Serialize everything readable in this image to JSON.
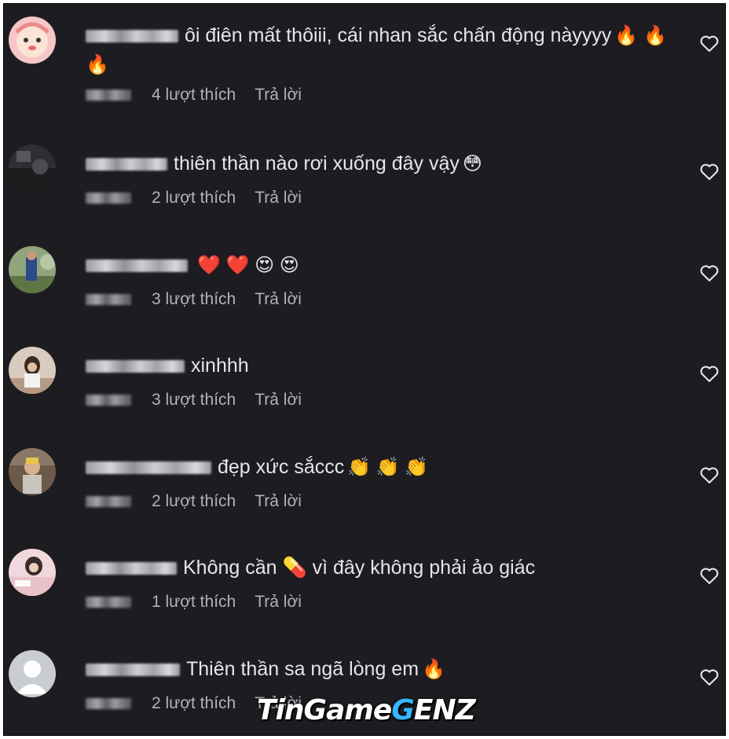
{
  "comments": [
    {
      "text": "ôi điên mất thôiii, cái nhan sắc chấn động nàyyyy",
      "emojis": "🔥 🔥 🔥",
      "likes": "4 lượt thích",
      "reply": "Trả lời",
      "avatar": "cartoon-avatar"
    },
    {
      "text": "thiên thần nào rơi xuống đây vậy",
      "emojis": "😳",
      "likes": "2 lượt thích",
      "reply": "Trả lời",
      "avatar": "dark-photo-avatar"
    },
    {
      "text": "",
      "emojis": "❤️ ❤️ 😍 😍",
      "likes": "3 lượt thích",
      "reply": "Trả lời",
      "avatar": "outdoor-photo-avatar"
    },
    {
      "text": "xinhhh",
      "emojis": "",
      "likes": "3 lượt thích",
      "reply": "Trả lời",
      "avatar": "girl-photo-avatar"
    },
    {
      "text": "đẹp xức sắccc",
      "emojis": "👏 👏 👏",
      "likes": "2 lượt thích",
      "reply": "Trả lời",
      "avatar": "selfie-photo-avatar"
    },
    {
      "text": "Không cần 💊 vì đây không phải ảo giác",
      "emojis": "",
      "likes": "1 lượt thích",
      "reply": "Trả lời",
      "avatar": "pink-photo-avatar"
    },
    {
      "text": "Thiên thần sa ngã lòng em",
      "emojis": "🔥",
      "likes": "2 lượt thích",
      "reply": "Trả lời",
      "avatar": "default-avatar"
    }
  ],
  "watermark": {
    "prefix": "TinGame",
    "g": "G",
    "suffix": "ENZ"
  },
  "colors": {
    "background": "#1c1c21",
    "text": "#e4e6eb",
    "meta": "#b0b3b8"
  }
}
